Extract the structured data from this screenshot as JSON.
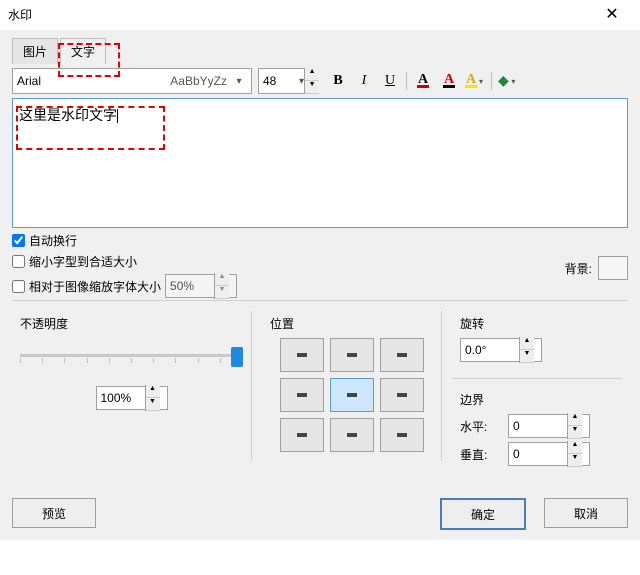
{
  "title": "水印",
  "tabs": {
    "image": "图片",
    "text": "文字"
  },
  "font": {
    "name": "Arial",
    "sample": "AaBbYyZz",
    "size": "48"
  },
  "format": {
    "bold": "B",
    "italic": "I",
    "underline": "U"
  },
  "textarea": {
    "value": "这里是水印文字"
  },
  "opts": {
    "autowrap": "自动换行",
    "shrinkfit": "缩小字型到合适大小",
    "scalefont": "相对于图像缩放字体大小",
    "scalefont_pct": "50%"
  },
  "background": {
    "label": "背景:"
  },
  "opacity": {
    "label": "不透明度",
    "value": "100%",
    "slider_pct": 100
  },
  "position": {
    "label": "位置",
    "selected": 4
  },
  "rotation": {
    "label": "旋转",
    "value": "0.0°"
  },
  "bounds": {
    "label": "边界",
    "horiz": "水平:",
    "vert": "垂直:",
    "h": "0",
    "v": "0"
  },
  "footer": {
    "preview": "预览",
    "ok": "确定",
    "cancel": "取消"
  }
}
